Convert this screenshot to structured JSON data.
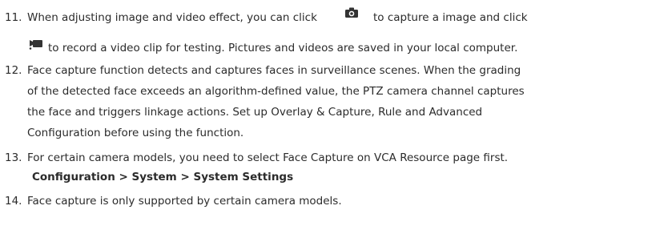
{
  "items": [
    {
      "number": "11.",
      "line1a": "When adjusting image and video effect, you can click",
      "line1b": "to capture a image and click",
      "line2b": "to record a video clip for testing. Pictures and videos are saved in your local computer.",
      "icon1": "camera-icon",
      "icon2": "video-camera-icon"
    },
    {
      "number": "12.",
      "lines": [
        "Face capture function detects and captures faces in surveillance scenes. When the grading",
        "of the detected face exceeds an algorithm-defined value, the PTZ camera channel captures",
        "the face and triggers linkage actions. Set up Overlay & Capture, Rule and Advanced",
        "Configuration before using the function."
      ]
    },
    {
      "number": "13.",
      "lines": [
        "For certain camera models, you need to select Face Capture on VCA Resource page first."
      ],
      "path": "Configuration > System > System Settings"
    },
    {
      "number": "14.",
      "lines": [
        "Face capture is only supported by certain camera models."
      ]
    }
  ]
}
